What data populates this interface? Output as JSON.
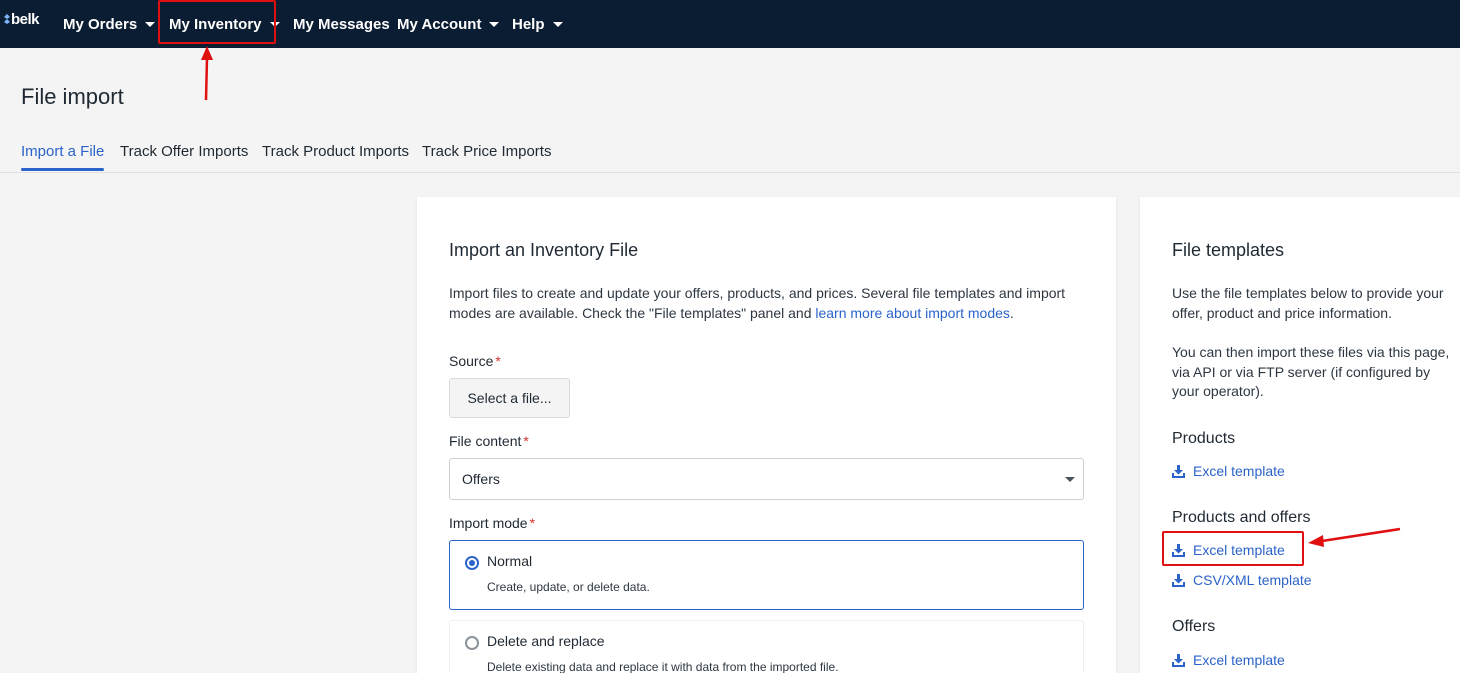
{
  "nav": {
    "logo_text": "belk",
    "items": [
      {
        "label": "My Orders",
        "has_caret": true
      },
      {
        "label": "My Inventory",
        "has_caret": true
      },
      {
        "label": "My Messages",
        "has_caret": false
      },
      {
        "label": "My Account",
        "has_caret": true
      },
      {
        "label": "Help",
        "has_caret": true
      }
    ]
  },
  "page": {
    "title": "File import",
    "tabs": [
      "Import a File",
      "Track Offer Imports",
      "Track Product Imports",
      "Track Price Imports"
    ],
    "active_tab": "Import a File"
  },
  "import_card": {
    "title": "Import an Inventory File",
    "description_part1": "Import files to create and update your offers, products, and prices. Several file templates and import modes are available. Check the \"File templates\" panel and ",
    "description_link": "learn more about import modes",
    "description_end": ".",
    "source_label": "Source",
    "select_file_button": "Select a file...",
    "file_content_label": "File content",
    "file_content_value": "Offers",
    "import_mode_label": "Import mode",
    "required_mark": "*",
    "modes": [
      {
        "title": "Normal",
        "description": "Create, update, or delete data.",
        "selected": true
      },
      {
        "title": "Delete and replace",
        "description": "Delete existing data and replace it with data from the imported file.",
        "selected": false
      }
    ]
  },
  "templates_card": {
    "title": "File templates",
    "intro1": "Use the file templates below to provide your offer, product and price information.",
    "intro2": "You can then import these files via this page, via API or via FTP server (if configured by your operator).",
    "sections": [
      {
        "heading": "Products",
        "links": [
          "Excel template"
        ]
      },
      {
        "heading": "Products and offers",
        "links": [
          "Excel template",
          "CSV/XML template"
        ]
      },
      {
        "heading": "Offers",
        "links": [
          "Excel template"
        ]
      }
    ]
  },
  "colors": {
    "nav_bg": "#0b1d33",
    "accent": "#2b63c9",
    "annotation_red": "#e01010"
  }
}
